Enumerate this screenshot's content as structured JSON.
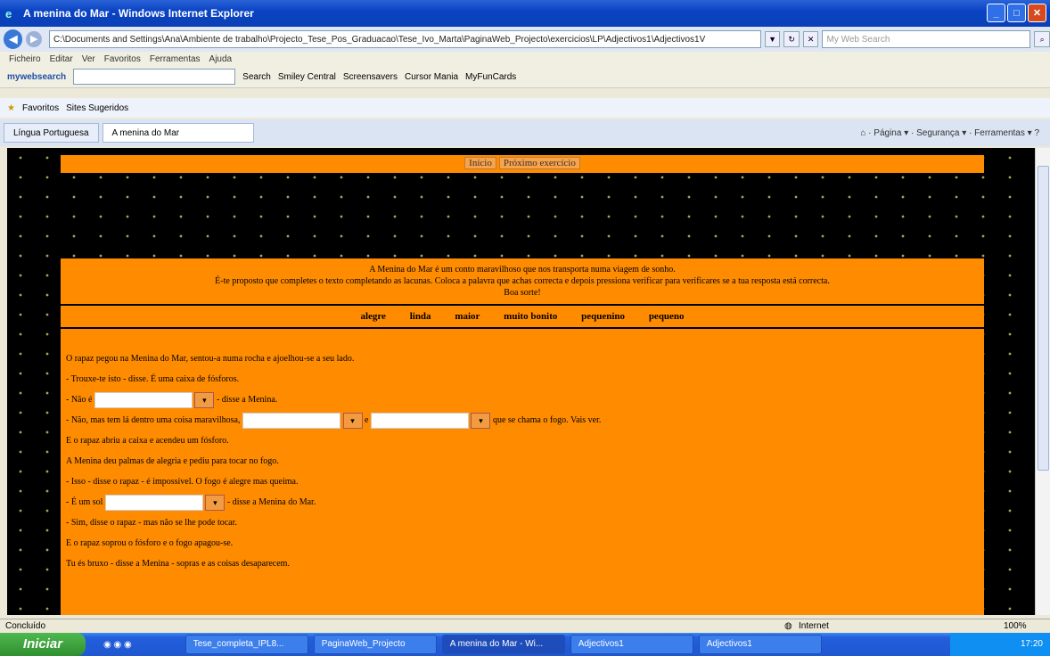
{
  "window": {
    "title": "A menina do Mar - Windows Internet Explorer"
  },
  "address": {
    "url": "C:\\Documents and Settings\\Ana\\Ambiente de trabalho\\Projecto_Tese_Pos_Graduacao\\Tese_Ivo_Marta\\PaginaWeb_Projecto\\exercicios\\LP\\Adjectivos1\\Adjectivos1V",
    "search_placeholder": "My Web Search"
  },
  "menu": [
    "Ficheiro",
    "Editar",
    "Ver",
    "Favoritos",
    "Ferramentas",
    "Ajuda"
  ],
  "toolbar2": {
    "brand": "mywebsearch",
    "search": "Search",
    "items": [
      "Smiley Central",
      "Screensavers",
      "Cursor Mania",
      "MyFunCards"
    ]
  },
  "favorites": {
    "label": "Favoritos",
    "suggested": "Sites Sugeridos"
  },
  "tabs": [
    {
      "label": "Língua Portuguesa"
    },
    {
      "label": "A menina do Mar"
    }
  ],
  "commands": {
    "page": "Página",
    "security": "Segurança",
    "tools": "Ferramentas"
  },
  "page": {
    "nav": {
      "home": "Início",
      "next": "Próximo exercício"
    },
    "intro": [
      "A Menina do Mar é um conto maravilhoso que nos transporta numa viagem de sonho.",
      "É-te proposto que completes o texto completando as lacunas. Coloca a palavra que achas correcta e depois pressiona verificar para verificares se a tua resposta está correcta.",
      "Boa sorte!"
    ],
    "words": [
      "alegre",
      "linda",
      "maior",
      "muito bonito",
      "pequenino",
      "pequeno"
    ],
    "story": {
      "l1": "O rapaz pegou na Menina do Mar, sentou-a numa rocha e ajoelhou-se a seu lado.",
      "l2": "- Trouxe-te isto - disse. É uma caixa de fósforos.",
      "l3a": "- Não é",
      "l3b": "- disse a Menina.",
      "l4a": "- Não, mas tem lá dentro uma coisa maravilhosa,",
      "l4b": "e",
      "l4c": "que se chama o fogo. Vais ver.",
      "l5": "E o rapaz abriu a caixa e acendeu um fósforo.",
      "l6": "A Menina deu palmas de alegria e pediu para tocar no fogo.",
      "l7": "- Isso - disse o rapaz - é impossível. O fogo é alegre mas queima.",
      "l8a": "- É um sol",
      "l8b": "- disse a Menina do Mar.",
      "l9": "- Sim, disse o rapaz - mas não se lhe pode tocar.",
      "l10": "E o rapaz soprou o fósforo e o fogo apagou-se.",
      "l11": "Tu és bruxo - disse a Menina - sopras e as coisas desaparecem."
    }
  },
  "status": {
    "left": "Concluído",
    "zone": "Internet",
    "zoom": "100%"
  },
  "taskbar": {
    "start": "Iniciar",
    "tasks": [
      "Tese_completa_IPL8...",
      "PaginaWeb_Projecto",
      "A menina do Mar - Wi...",
      "Adjectivos1",
      "Adjectivos1"
    ],
    "clock": "17:20"
  }
}
